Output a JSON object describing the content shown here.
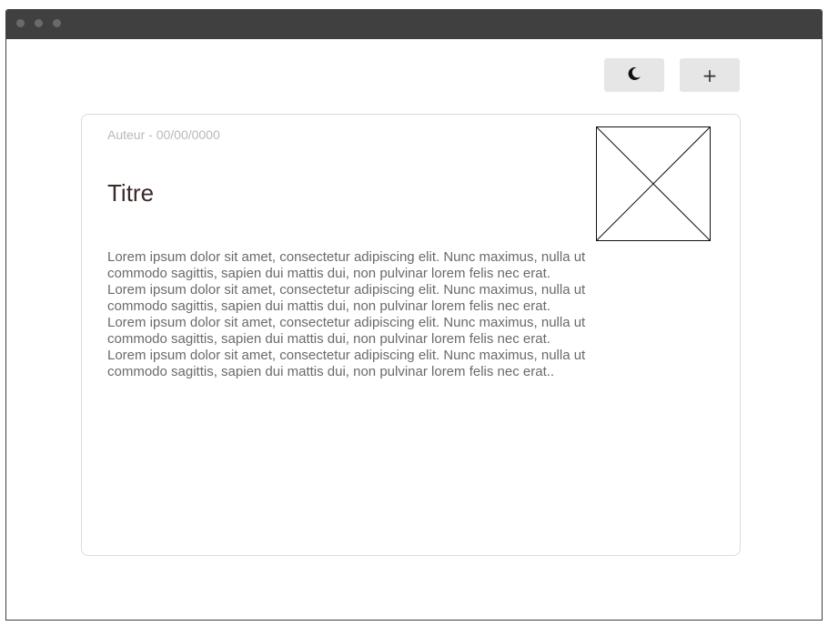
{
  "window": {
    "controls": [
      "close",
      "minimize",
      "maximize"
    ]
  },
  "toolbar": {
    "theme_button_icon": "moon-icon",
    "add_button_label": "+"
  },
  "article": {
    "meta": "Auteur - 00/00/0000",
    "title": "Titre",
    "body": "Lorem ipsum dolor sit amet, consectetur adipiscing elit. Nunc maximus, nulla ut commodo sagittis, sapien dui mattis dui, non pulvinar lorem felis nec erat. Lorem ipsum dolor sit amet, consectetur adipiscing elit. Nunc maximus, nulla ut commodo sagittis, sapien dui mattis dui, non pulvinar lorem felis nec erat. Lorem ipsum dolor sit amet, consectetur adipiscing elit. Nunc maximus, nulla ut commodo sagittis, sapien dui mattis dui, non pulvinar lorem felis nec erat. Lorem ipsum dolor sit amet, consectetur adipiscing elit. Nunc maximus, nulla ut commodo sagittis, sapien dui mattis dui, non pulvinar lorem felis nec erat..",
    "image_icon": "image-placeholder-icon"
  },
  "colors": {
    "titlebar": "#404040",
    "button_bg": "#e6e6e6",
    "meta_text": "#b9b9b9",
    "title_text": "#3b2a2a",
    "body_text": "#6a6a6a"
  }
}
